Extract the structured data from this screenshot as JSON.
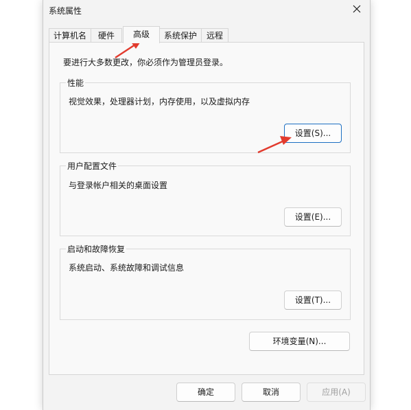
{
  "window": {
    "title": "系统属性"
  },
  "tabs": [
    {
      "label": "计算机名"
    },
    {
      "label": "硬件"
    },
    {
      "label": "高级",
      "active": true
    },
    {
      "label": "系统保护"
    },
    {
      "label": "远程"
    }
  ],
  "notice": "要进行大多数更改，你必须作为管理员登录。",
  "groups": {
    "performance": {
      "title": "性能",
      "description": "视觉效果，处理器计划，内存使用，以及虚拟内存",
      "button": "设置(S)..."
    },
    "user_profiles": {
      "title": "用户配置文件",
      "description": "与登录帐户相关的桌面设置",
      "button": "设置(E)..."
    },
    "startup_recovery": {
      "title": "启动和故障恢复",
      "description": "系统启动、系统故障和调试信息",
      "button": "设置(T)..."
    }
  },
  "env_button": "环境变量(N)...",
  "footer": {
    "ok": "确定",
    "cancel": "取消",
    "apply": "应用(A)"
  },
  "colors": {
    "annotation_arrow": "#e23b2e",
    "focus_border": "#1b6ec2"
  },
  "icons": {
    "close": "close-icon"
  }
}
